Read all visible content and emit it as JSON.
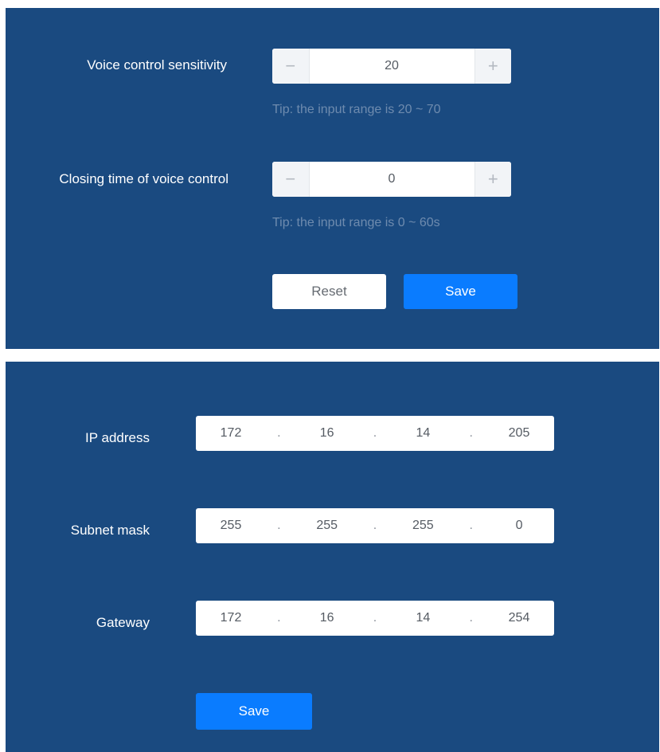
{
  "voice_settings": {
    "sensitivity": {
      "label": "Voice control sensitivity",
      "value": "20",
      "minus_glyph": "−",
      "plus_glyph": "+",
      "tip": "Tip: the input range is 20 ~ 70"
    },
    "closing_time": {
      "label": "Closing time of voice control",
      "value": "0",
      "minus_glyph": "−",
      "plus_glyph": "+",
      "tip": "Tip: the input range is 0 ~ 60s"
    },
    "reset_label": "Reset",
    "save_label": "Save"
  },
  "network_settings": {
    "ip_address": {
      "label": "IP address",
      "octets": [
        "172",
        "16",
        "14",
        "205"
      ]
    },
    "subnet_mask": {
      "label": "Subnet mask",
      "octets": [
        "255",
        "255",
        "255",
        "0"
      ]
    },
    "gateway": {
      "label": "Gateway",
      "octets": [
        "172",
        "16",
        "14",
        "254"
      ]
    },
    "separator": ".",
    "save_label": "Save"
  },
  "colors": {
    "panel_background": "#1a4a80",
    "primary_button": "#0a7cff",
    "tip_text": "#6e8bae"
  },
  "icons": {
    "decrement": "minus-icon",
    "increment": "plus-icon"
  }
}
